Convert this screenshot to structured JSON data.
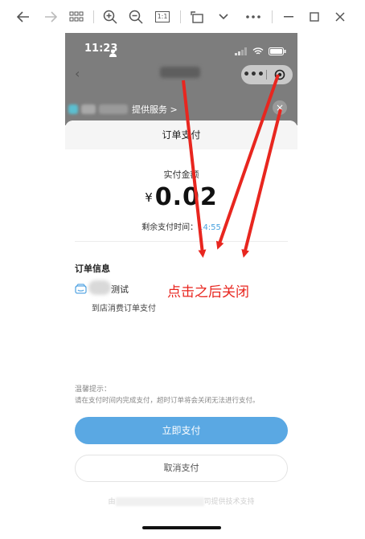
{
  "viewer_toolbar": {
    "icons": [
      "back-arrow-icon",
      "forward-arrow-icon",
      "grid-view-icon",
      "zoom-in-icon",
      "zoom-out-icon",
      "actual-size-icon",
      "rotate-icon",
      "chevron-down-icon",
      "more-icon",
      "minimize-icon",
      "maximize-icon",
      "close-icon"
    ],
    "actual_size_label": "1:1"
  },
  "status_bar": {
    "time": "11:23"
  },
  "mini_program": {
    "capsule_more": "•••",
    "service_label": "提供服务 >",
    "close_glyph": "×"
  },
  "sheet": {
    "title": "订单支付",
    "paid_label": "实付金额",
    "currency": "¥",
    "amount": "0.02",
    "remaining_label": "剩余支付时间：",
    "remaining_time": "14:55",
    "order_info_title": "订单信息",
    "order_name": "测试",
    "order_subtitle": "到店消费订单支付",
    "tips_title": "温馨提示：",
    "tips_body": "请在支付时间内完成支付，超时订单将会关闭无法进行支付。",
    "pay_button": "立即支付",
    "cancel_button": "取消支付",
    "footer_prefix": "由",
    "footer_suffix": "司提供技术支持"
  },
  "annotation": {
    "text": "点击之后关闭",
    "color": "#e8261f"
  },
  "colors": {
    "pay_button": "#5aa8e3",
    "countdown": "#4aa3df",
    "overlay": "#7d7d7d"
  }
}
